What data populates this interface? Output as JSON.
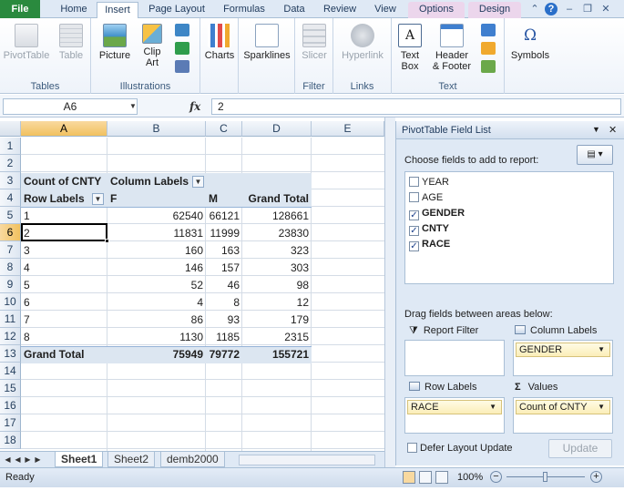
{
  "tabs": [
    "File",
    "Home",
    "Insert",
    "Page Layout",
    "Formulas",
    "Data",
    "Review",
    "View",
    "Options",
    "Design"
  ],
  "ribbon": {
    "groups": {
      "tables": "Tables",
      "illustrations": "Illustrations",
      "filter": "Filter",
      "links": "Links",
      "text": "Text"
    },
    "buttons": {
      "pivottable": "PivotTable",
      "table": "Table",
      "picture": "Picture",
      "clip_art_1": "Clip",
      "clip_art_2": "Art",
      "charts": "Charts",
      "sparklines": "Sparklines",
      "slicer": "Slicer",
      "hyperlink": "Hyperlink",
      "text_box_1": "Text",
      "text_box_2": "Box",
      "header_1": "Header",
      "header_2": "& Footer",
      "symbols": "Symbols"
    }
  },
  "formula_bar": {
    "name_box": "A6",
    "fx": "fx",
    "value": "2"
  },
  "columns": [
    "A",
    "B",
    "C",
    "D",
    "E"
  ],
  "rows": [
    "1",
    "2",
    "3",
    "4",
    "5",
    "6",
    "7",
    "8",
    "9",
    "10",
    "11",
    "12",
    "13",
    "14",
    "15",
    "16",
    "17",
    "18"
  ],
  "pivot": {
    "count_label": "Count of CNTY",
    "column_labels": "Column Labels",
    "row_labels": "Row Labels",
    "col_f": "F",
    "col_m": "M",
    "grand_total_col": "Grand Total",
    "data": [
      {
        "label": "1",
        "f": "62540",
        "m": "66121",
        "total": "128661"
      },
      {
        "label": "2",
        "f": "11831",
        "m": "11999",
        "total": "23830"
      },
      {
        "label": "3",
        "f": "160",
        "m": "163",
        "total": "323"
      },
      {
        "label": "4",
        "f": "146",
        "m": "157",
        "total": "303"
      },
      {
        "label": "5",
        "f": "52",
        "m": "46",
        "total": "98"
      },
      {
        "label": "6",
        "f": "4",
        "m": "8",
        "total": "12"
      },
      {
        "label": "7",
        "f": "86",
        "m": "93",
        "total": "179"
      },
      {
        "label": "8",
        "f": "1130",
        "m": "1185",
        "total": "2315"
      }
    ],
    "grand_total": {
      "label": "Grand Total",
      "f": "75949",
      "m": "79772",
      "total": "155721"
    }
  },
  "sheets": [
    "Sheet1",
    "Sheet2",
    "demb2000"
  ],
  "status": {
    "ready": "Ready",
    "zoom": "100%"
  },
  "pane": {
    "title": "PivotTable Field List",
    "choose": "Choose fields to add to report:",
    "fields": [
      {
        "name": "YEAR",
        "checked": false
      },
      {
        "name": "AGE",
        "checked": false
      },
      {
        "name": "GENDER",
        "checked": true
      },
      {
        "name": "CNTY",
        "checked": true
      },
      {
        "name": "RACE",
        "checked": true
      }
    ],
    "drag": "Drag fields between areas below:",
    "report_filter": "Report Filter",
    "column_labels": "Column Labels",
    "row_labels": "Row Labels",
    "values": "Values",
    "col_field": "GENDER",
    "row_field": "RACE",
    "value_field": "Count of CNTY",
    "defer": "Defer Layout Update",
    "update": "Update"
  }
}
